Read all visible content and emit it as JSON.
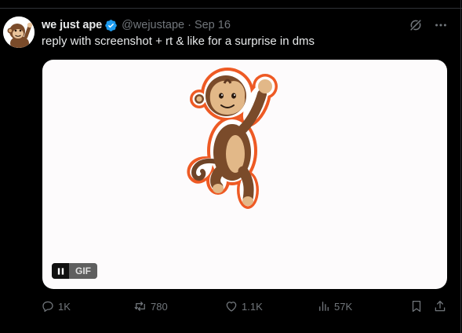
{
  "tweet": {
    "display_name": "we just ape",
    "handle": "@wejustape",
    "separator": "·",
    "date": "Sep 16",
    "text": "reply with screenshot + rt & like for a surprise in dms",
    "verified": true,
    "accent_color": "#1d9bf0"
  },
  "media": {
    "type": "GIF",
    "badge_label": "GIF",
    "playback": "pause-icon",
    "subject": "monkey-sticker-image"
  },
  "actions": {
    "replies": "1K",
    "reposts": "780",
    "likes": "1.1K",
    "views": "57K"
  },
  "icons": {
    "top": [
      "grok-icon",
      "more-icon"
    ],
    "actions": [
      "reply-icon",
      "repost-icon",
      "like-icon",
      "views-icon",
      "bookmark-icon",
      "share-icon"
    ]
  }
}
